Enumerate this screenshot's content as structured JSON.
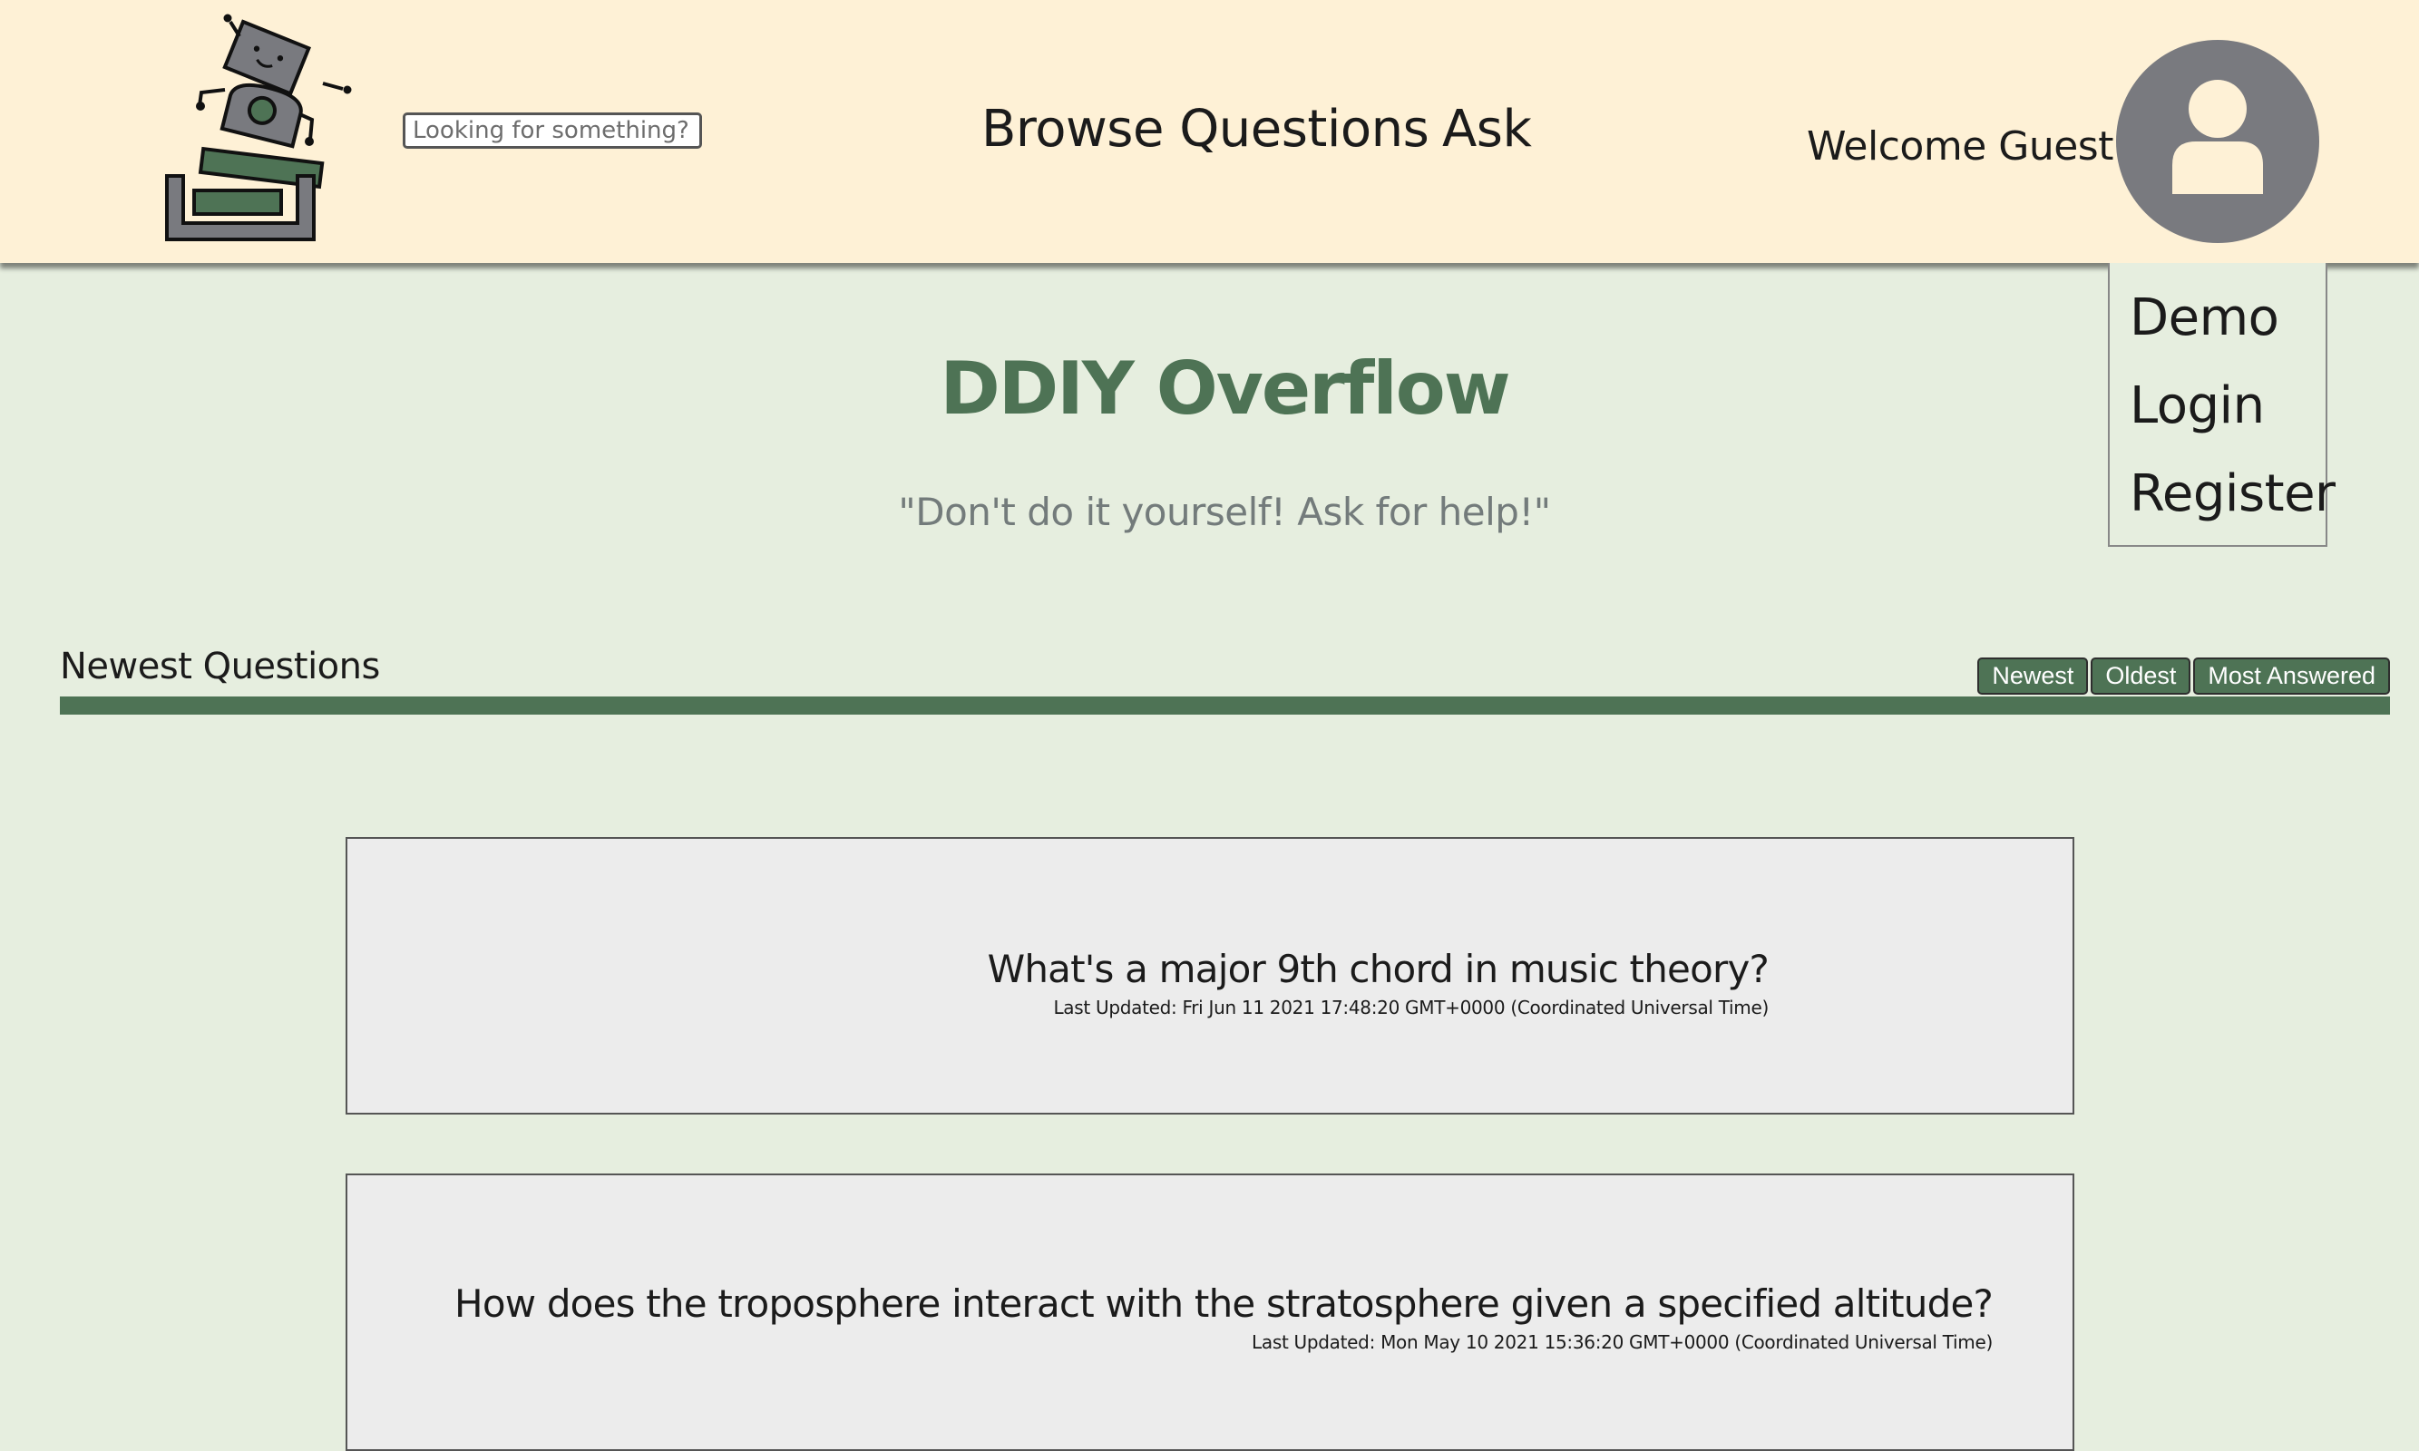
{
  "header": {
    "search": {
      "placeholder": "Looking for something?"
    },
    "nav": {
      "browse_label": "Browse Questions",
      "ask_label": "Ask"
    },
    "welcome_text": "Welcome Guest!",
    "avatar_icon": "user-icon",
    "logo_icon": "robot-logo"
  },
  "user_menu": {
    "items": [
      "Demo",
      "Login",
      "Register"
    ]
  },
  "hero": {
    "title": "DDIY Overflow",
    "tagline": "\"Don't do it yourself! Ask for help!\""
  },
  "questions_section": {
    "title": "Newest Questions",
    "sort_options": [
      "Newest",
      "Oldest",
      "Most Answered"
    ]
  },
  "questions": [
    {
      "title": "What's a major 9th chord in music theory?",
      "updated": "Last Updated: Fri Jun 11 2021 17:48:20 GMT+0000 (Coordinated Universal Time)"
    },
    {
      "title": "How does the troposphere interact with the stratosphere given a specified altitude?",
      "updated": "Last Updated: Mon May 10 2021 15:36:20 GMT+0000 (Coordinated Universal Time)"
    }
  ],
  "colors": {
    "header_bg": "#fef1d6",
    "page_bg": "#e6eedf",
    "accent_green": "#4e7355",
    "avatar_gray": "#797a7f",
    "card_bg": "#ececec"
  }
}
